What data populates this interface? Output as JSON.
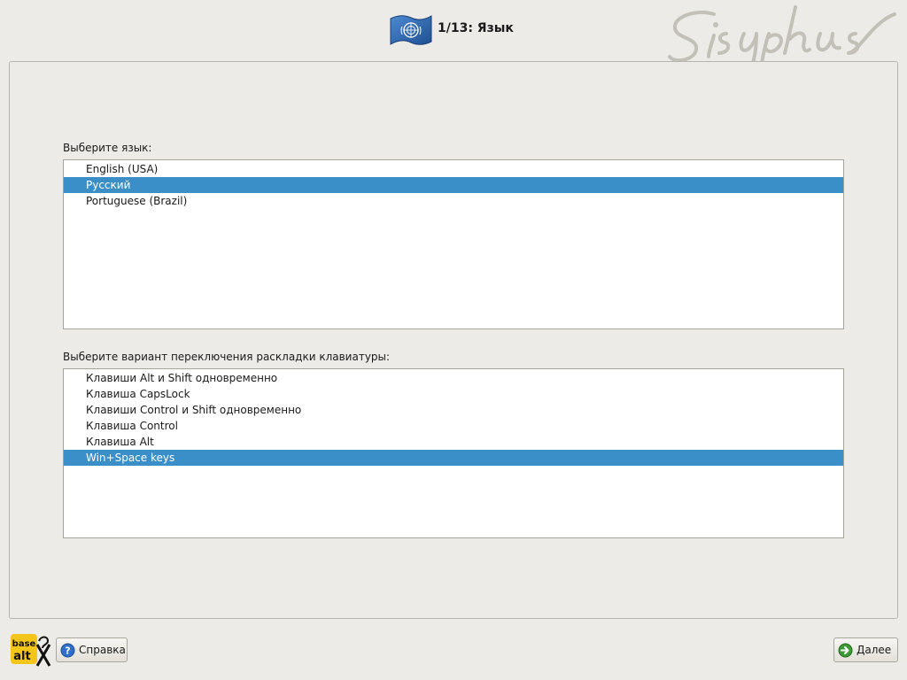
{
  "header": {
    "title": "1/13: Язык",
    "flag_icon": "un-flag-icon",
    "signature_text": "Sisyphus"
  },
  "language_section": {
    "label": "Выберите язык:",
    "items": [
      {
        "label": "English (USA)",
        "selected": false
      },
      {
        "label": "Русский",
        "selected": true
      },
      {
        "label": "Portuguese (Brazil)",
        "selected": false
      }
    ]
  },
  "layout_section": {
    "label": "Выберите вариант переключения раскладки клавиатуры:",
    "items": [
      {
        "label": "Клавиши Alt и Shift одновременно",
        "selected": false
      },
      {
        "label": "Клавиша CapsLock",
        "selected": false
      },
      {
        "label": "Клавиши Control и Shift одновременно",
        "selected": false
      },
      {
        "label": "Клавиша Control",
        "selected": false
      },
      {
        "label": "Клавиша Alt",
        "selected": false
      },
      {
        "label": "Win+Space keys",
        "selected": true
      }
    ]
  },
  "footer": {
    "logo_text_top": "base",
    "logo_text_bottom": "alt",
    "help_label": "Справка",
    "next_label": "Далее"
  },
  "colors": {
    "background": "#edebe7",
    "selection": "#3a8fc9",
    "flag_blue": "#2f6db3"
  }
}
